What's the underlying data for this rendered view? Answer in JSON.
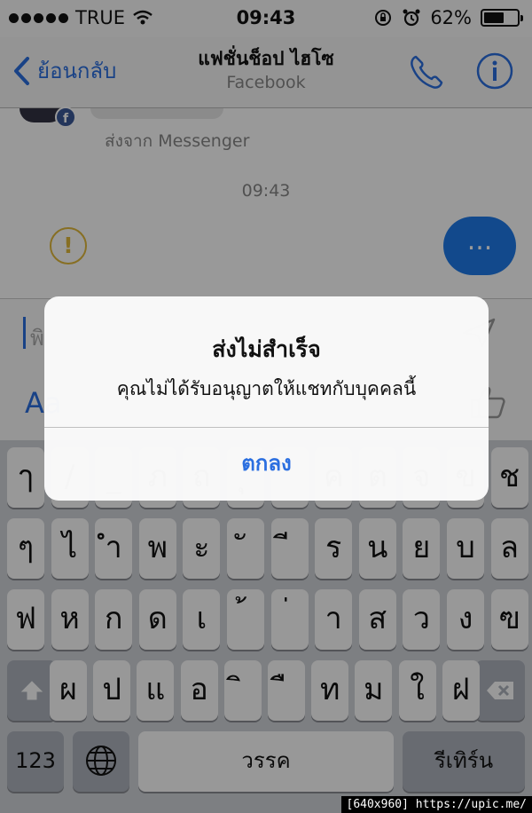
{
  "status_bar": {
    "carrier": "TRUE",
    "time": "09:43",
    "battery_percent": "62%",
    "battery_level": 0.62
  },
  "nav": {
    "back_label": "ย้อนกลับ",
    "title": "แฟชั่นช็อป ไฮโซ",
    "subtitle": "Facebook"
  },
  "conversation": {
    "sent_from": "ส่งจาก Messenger",
    "timestamp": "09:43",
    "outgoing_bubble_text": "...",
    "error_icon_glyph": "!"
  },
  "composer": {
    "placeholder": "พิ",
    "format_label": "Aa"
  },
  "keyboard": {
    "rows": [
      [
        "ๅ",
        "/",
        "_",
        "ภ",
        "ถ",
        "ุ",
        "ึ",
        "ค",
        "ต",
        "จ",
        "ข",
        "ช"
      ],
      [
        "ๆ",
        "ไ",
        "ำ",
        "พ",
        "ะ",
        "ั",
        "ี",
        "ร",
        "น",
        "ย",
        "บ",
        "ล"
      ],
      [
        "ฟ",
        "ห",
        "ก",
        "ด",
        "เ",
        "้",
        "่",
        "า",
        "ส",
        "ว",
        "ง",
        "ฃ"
      ],
      [
        "ผ",
        "ป",
        "แ",
        "อ",
        "ิ",
        "ื",
        "ท",
        "ม",
        "ใ",
        "ฝ"
      ]
    ],
    "numbers_label": "123",
    "space_label": "วรรค",
    "return_label": "รีเทิร์น"
  },
  "alert": {
    "title": "ส่งไม่สำเร็จ",
    "message": "คุณไม่ได้รับอนุญาตให้แชทกับบุคคลนี้",
    "button_label": "ตกลง"
  },
  "watermark": "[640x960] https://upic.me/",
  "colors": {
    "accent": "#2b6fe0",
    "warning": "#e2b93b",
    "outgoing_bubble": "#1f7bea",
    "keyboard_bg": "#d1d4d9"
  }
}
